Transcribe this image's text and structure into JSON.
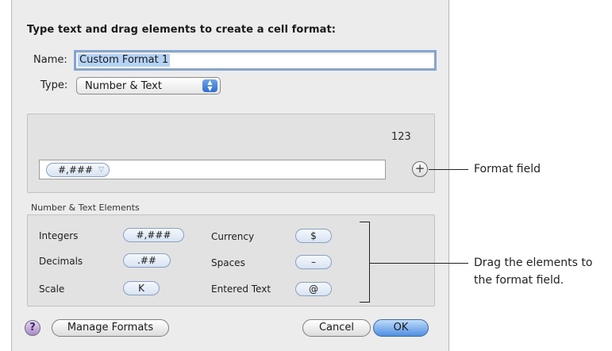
{
  "dialog": {
    "heading": "Type text and drag elements to create a cell format:",
    "name_label": "Name:",
    "name_value": "Custom Format 1",
    "type_label": "Type:",
    "type_value": "Number & Text",
    "format_preview": "123",
    "format_token": "#,###",
    "elements_section_label": "Number & Text Elements",
    "elements": [
      {
        "label": "Integers",
        "token": "#,###"
      },
      {
        "label": "Decimals",
        "token": ".##"
      },
      {
        "label": "Scale",
        "token": "K"
      },
      {
        "label": "Currency",
        "token": "$"
      },
      {
        "label": "Spaces",
        "token": "–"
      },
      {
        "label": "Entered Text",
        "token": "@"
      }
    ],
    "buttons": {
      "help": "?",
      "manage_formats": "Manage Formats",
      "cancel": "Cancel",
      "ok": "OK"
    }
  },
  "callouts": {
    "format_field": "Format field",
    "drag_line1": "Drag the elements to",
    "drag_line2": "the format field."
  },
  "colors": {
    "sheet_bg": "#ececec",
    "panel_bg": "#e2e2e2",
    "token_border": "#8aa0c2",
    "ok_button": "#4f8fe0",
    "selection": "#b5d2f5"
  },
  "icons": [
    "popup-arrows-icon",
    "add-icon",
    "chevron-down-icon",
    "help-icon"
  ]
}
